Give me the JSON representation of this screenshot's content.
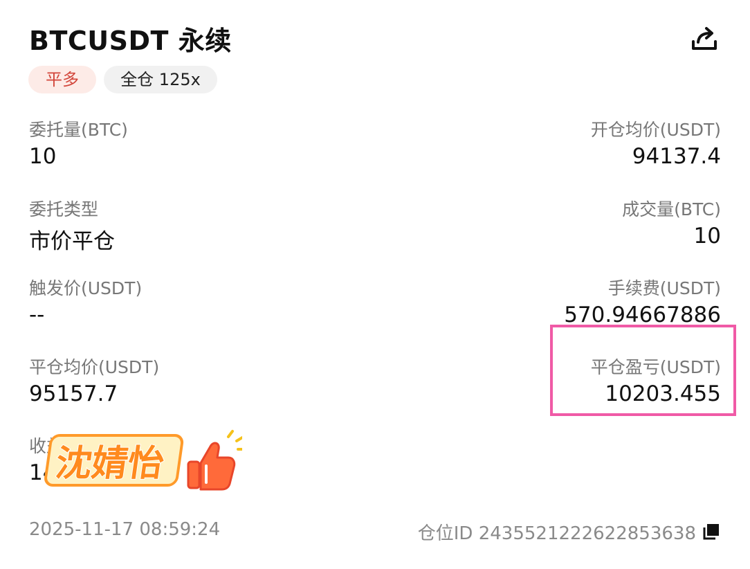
{
  "header": {
    "title": "BTCUSDT 永续",
    "share_icon": "share-icon"
  },
  "tags": {
    "side": "平多",
    "mode": "全仓 125x"
  },
  "fields": {
    "order_qty_label": "委托量(BTC)",
    "order_qty_value": "10",
    "open_avg_label": "开仓均价(USDT)",
    "open_avg_value": "94137.4",
    "order_type_label": "委托类型",
    "order_type_value": "市价平仓",
    "filled_qty_label": "成交量(BTC)",
    "filled_qty_value": "10",
    "trigger_label": "触发价(USDT)",
    "trigger_value": "--",
    "fee_label": "手续费(USDT)",
    "fee_value": "570.94667886",
    "close_avg_label": "平仓均价(USDT)",
    "close_avg_value": "95157.7",
    "pnl_label": "平仓盈亏(USDT)",
    "pnl_value": "10203.455",
    "return_label": "收益率",
    "return_value": "14"
  },
  "overlay": {
    "name": "沈婧怡",
    "icon": "thumbs-up-icon"
  },
  "footer": {
    "time": "2025-11-17 08:59:24",
    "position_id": "仓位ID 2435521222622853638",
    "copy_icon": "copy-icon"
  },
  "colors": {
    "side_tag_text": "#d2453a",
    "side_tag_bg": "#fdebe7",
    "highlight": "#f05aa6",
    "overlay_text": "#ff8a1e"
  }
}
